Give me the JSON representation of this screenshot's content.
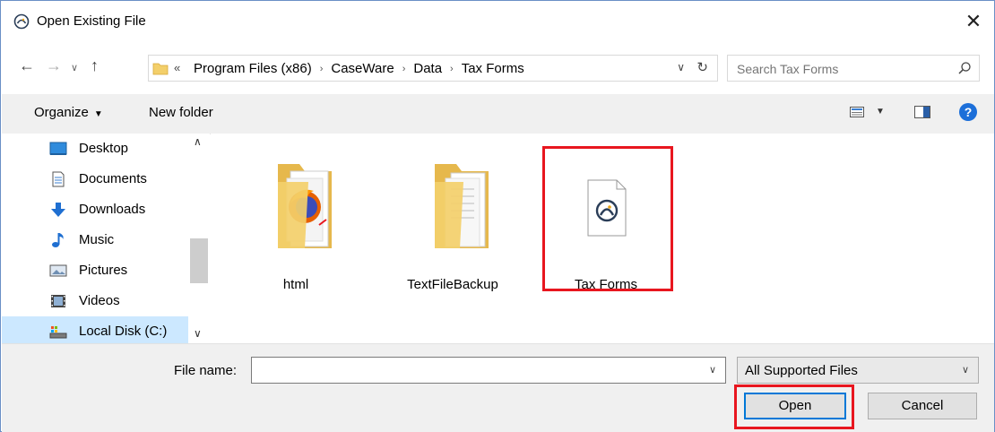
{
  "window": {
    "title": "Open Existing File",
    "close_glyph": "✕"
  },
  "address": {
    "overflow_glyph": "«",
    "crumbs": [
      "Program Files (x86)",
      "CaseWare",
      "Data",
      "Tax Forms"
    ],
    "separator": "›",
    "dropdown_glyph": "∨",
    "refresh_glyph": "↻"
  },
  "search": {
    "placeholder": "Search Tax Forms"
  },
  "toolbar": {
    "organize": "Organize",
    "new_folder": "New folder",
    "help": "?"
  },
  "nav": {
    "items": [
      {
        "label": "Desktop",
        "icon": "desktop-icon"
      },
      {
        "label": "Documents",
        "icon": "documents-icon"
      },
      {
        "label": "Downloads",
        "icon": "downloads-icon"
      },
      {
        "label": "Music",
        "icon": "music-icon"
      },
      {
        "label": "Pictures",
        "icon": "pictures-icon"
      },
      {
        "label": "Videos",
        "icon": "videos-icon"
      },
      {
        "label": "Local Disk (C:)",
        "icon": "local-disk-icon",
        "selected": true
      }
    ]
  },
  "files": [
    {
      "label": "html",
      "type": "folder"
    },
    {
      "label": "TextFileBackup",
      "type": "folder"
    },
    {
      "label": "Tax Forms",
      "type": "caseware-file",
      "highlighted": true
    }
  ],
  "bottom": {
    "file_name_label": "File name:",
    "file_name_value": "",
    "file_type": "All Supported Files",
    "open": "Open",
    "cancel": "Cancel"
  },
  "colors": {
    "highlight": "#e8161f",
    "accent": "#0078d7",
    "selected": "#cce8ff"
  }
}
